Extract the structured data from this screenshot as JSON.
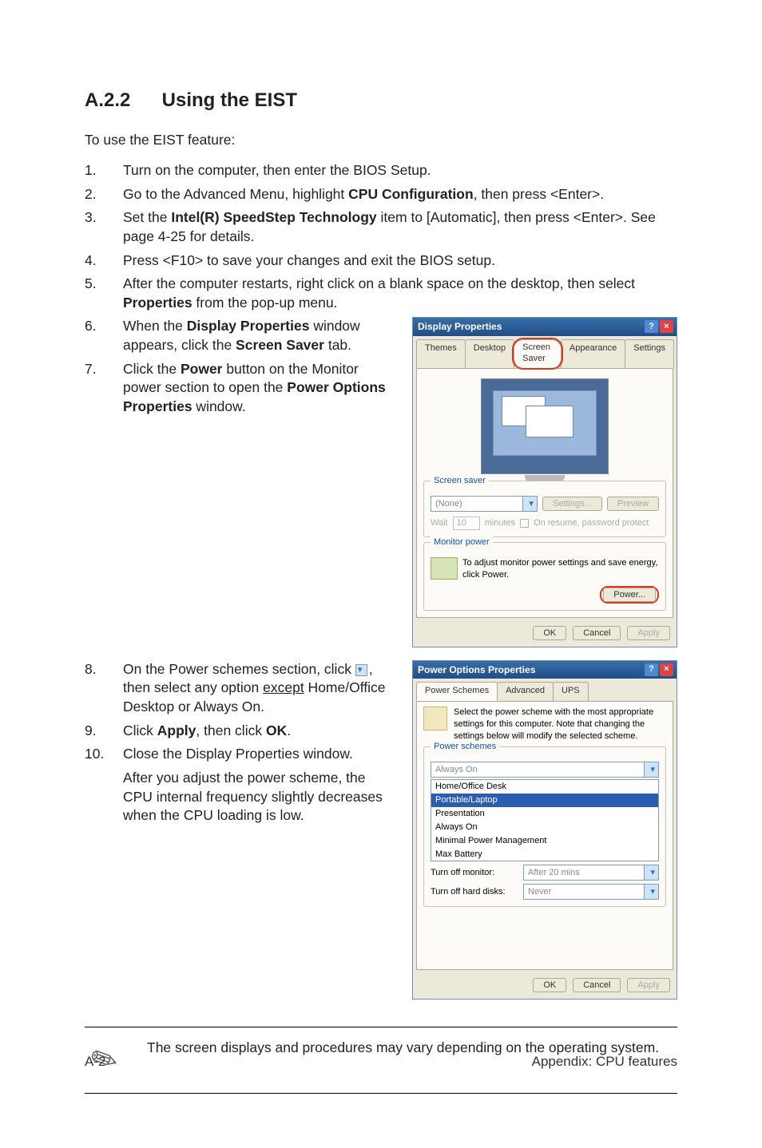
{
  "section": {
    "number": "A.2.2",
    "title": "Using the EIST"
  },
  "intro": "To use the EIST feature:",
  "steps": {
    "s1": {
      "num": "1.",
      "text": "Turn on the computer, then enter the BIOS Setup."
    },
    "s2": {
      "num": "2.",
      "a": "Go to the Advanced Menu, highlight ",
      "b": "CPU Configuration",
      "c": ", then press <Enter>."
    },
    "s3": {
      "num": "3.",
      "a": "Set the ",
      "b": "Intel(R) SpeedStep Technology",
      "c": " item to [Automatic], then press <Enter>. See page 4-25 for details."
    },
    "s4": {
      "num": "4.",
      "text": "Press <F10> to save your changes and exit the BIOS setup."
    },
    "s5": {
      "num": "5.",
      "a": "After the computer restarts, right click on a blank space on the desktop, then select ",
      "b": "Properties",
      "c": " from the pop-up menu."
    },
    "s6": {
      "num": "6.",
      "a": "When the ",
      "b": "Display Properties",
      "c": " window appears, click the ",
      "d": "Screen Saver",
      "e": " tab."
    },
    "s7": {
      "num": "7.",
      "a": "Click the ",
      "b": "Power",
      "c": " button on the Monitor power section to open the ",
      "d": "Power Options Properties",
      "e": " window."
    },
    "s8": {
      "num": "8.",
      "a": "On the Power schemes section, click ",
      "b": ", then select any option ",
      "c": "except",
      "d": " Home/Office Desktop or Always On."
    },
    "s9": {
      "num": "9.",
      "a": "Click ",
      "b": "Apply",
      "c": ", then click ",
      "d": "OK",
      "e": "."
    },
    "s10": {
      "num": "10.",
      "a": "Close the Display Properties window.",
      "b": "After you adjust the power scheme, the CPU internal frequency slightly decreases when the CPU loading is low."
    }
  },
  "note": "The screen displays and procedures may vary depending on the operating system.",
  "footer": {
    "left": "A-2",
    "right": "Appendix: CPU features"
  },
  "dlg1": {
    "title": "Display Properties",
    "tabs": {
      "t1": "Themes",
      "t2": "Desktop",
      "t3": "Screen Saver",
      "t4": "Appearance",
      "t5": "Settings"
    },
    "ss_legend": "Screen saver",
    "ss_value": "(None)",
    "settings_btn": "Settings...",
    "preview_btn": "Preview",
    "wait_label": "Wait",
    "wait_value": "10",
    "wait_unit": "minutes",
    "resume_cb": "On resume, password protect",
    "mp_legend": "Monitor power",
    "mp_text": "To adjust monitor power settings and save energy, click Power.",
    "power_btn": "Power...",
    "ok": "OK",
    "cancel": "Cancel",
    "apply": "Apply"
  },
  "dlg2": {
    "title": "Power Options Properties",
    "tabs": {
      "t1": "Power Schemes",
      "t2": "Advanced",
      "t3": "UPS"
    },
    "desc": "Select the power scheme with the most appropriate settings for this computer. Note that changing the settings below will modify the selected scheme.",
    "ps_legend": "Power schemes",
    "ps_value": "Always On",
    "opts": {
      "o1": "Home/Office Desk",
      "o2": "Portable/Laptop",
      "o3": "Presentation",
      "o4": "Always On",
      "o5": "Minimal Power Management",
      "o6": "Max Battery"
    },
    "row1_label": "Turn off monitor:",
    "row1_value": "After 20 mins",
    "row2_label": "Turn off hard disks:",
    "row2_value": "Never",
    "ok": "OK",
    "cancel": "Cancel",
    "apply": "Apply"
  }
}
